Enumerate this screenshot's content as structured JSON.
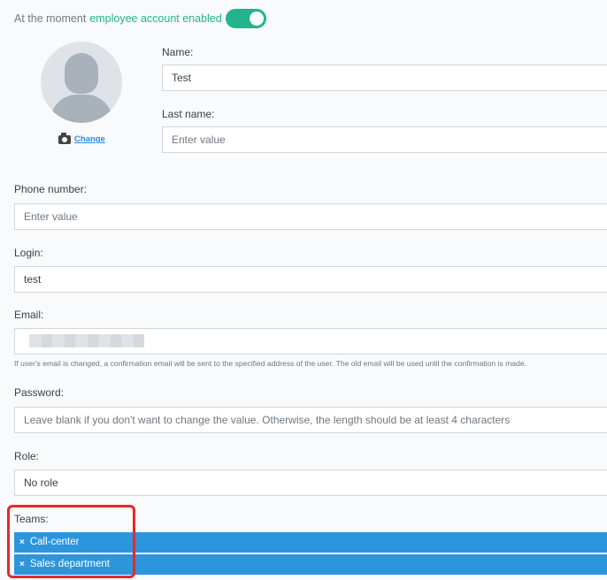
{
  "status": {
    "prefix": "At the moment",
    "state_text": "employee account enabled",
    "enabled": true
  },
  "avatar": {
    "change_label": "Change"
  },
  "fields": {
    "name": {
      "label": "Name:",
      "value": "Test"
    },
    "last_name": {
      "label": "Last name:",
      "placeholder": "Enter value"
    },
    "phone": {
      "label": "Phone number:",
      "placeholder": "Enter value"
    },
    "login": {
      "label": "Login:",
      "value": "test"
    },
    "email": {
      "label": "Email:",
      "hint": "If user's email is changed, a confirmation email will be sent to the specified address of the user. The old email will be used until the confirmation is made."
    },
    "password": {
      "label": "Password:",
      "placeholder": "Leave blank if you don't want to change the value. Otherwise, the length should be at least 4 characters"
    },
    "role": {
      "label": "Role:",
      "value": "No role"
    }
  },
  "teams": {
    "label": "Teams:",
    "items": [
      "Call-center",
      "Sales department"
    ],
    "remove_glyph": "×"
  },
  "colors": {
    "accent_green": "#21b48e",
    "team_blue": "#2d95dc",
    "highlight_red": "#e62a2a"
  }
}
